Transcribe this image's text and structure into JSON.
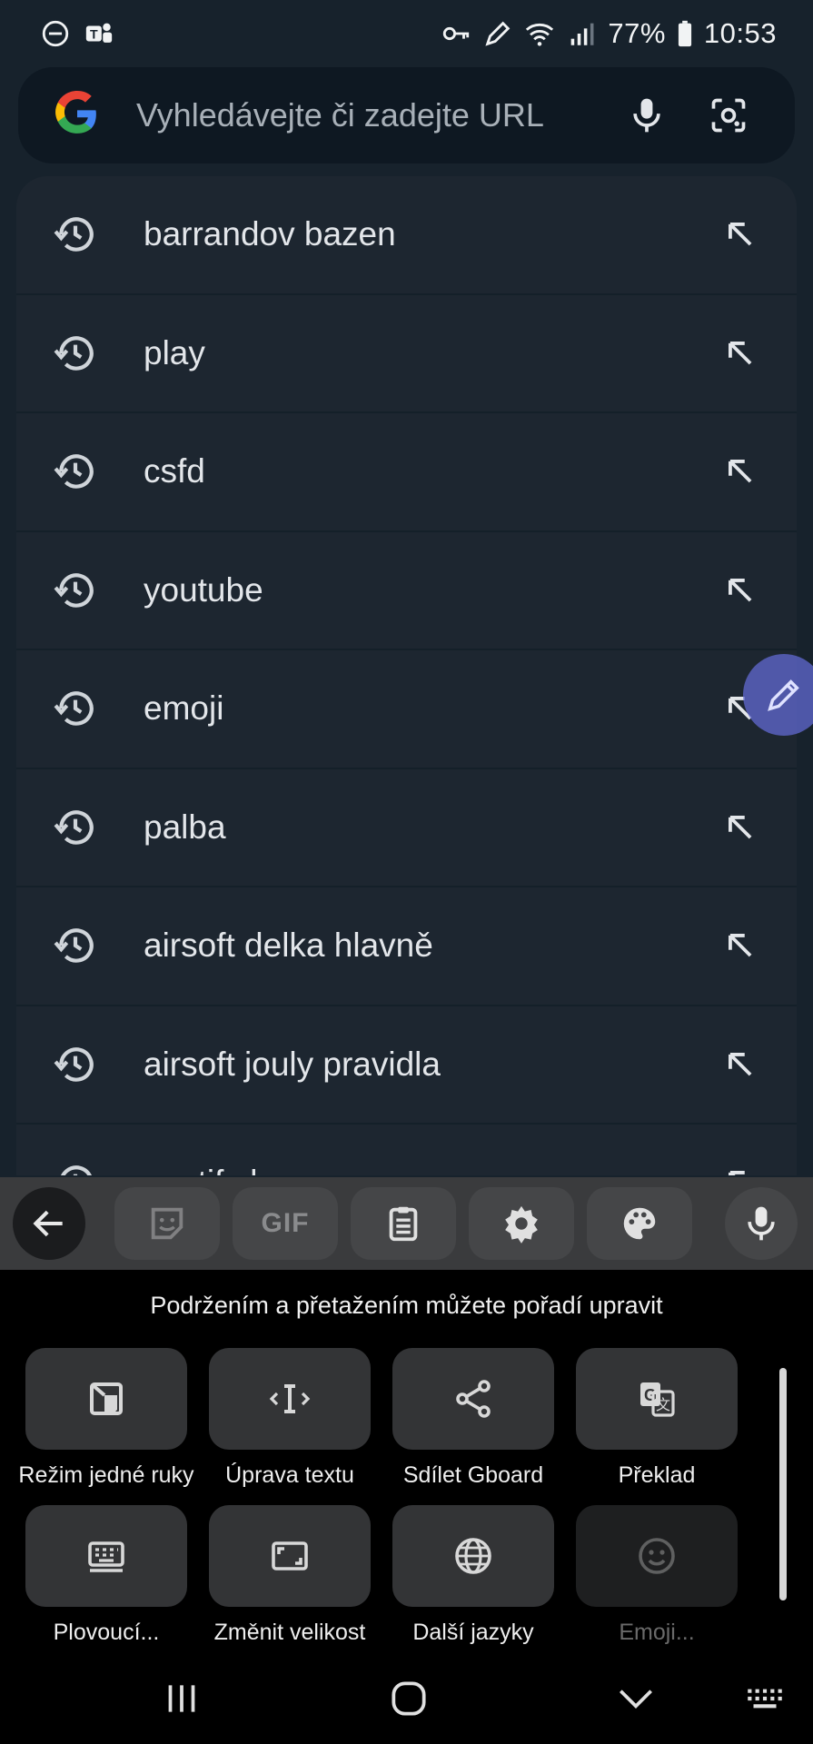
{
  "status_bar": {
    "battery": "77%",
    "time": "10:53",
    "left_icons": [
      "do-not-disturb-icon",
      "teams-icon"
    ],
    "right_icons": [
      "vpn-key-icon",
      "pen-icon",
      "wifi-icon",
      "signal-icon",
      "battery-icon"
    ]
  },
  "search": {
    "placeholder": "Vyhledávejte či zadejte URL",
    "icons": [
      "google-logo",
      "mic-icon",
      "lens-camera-icon"
    ]
  },
  "suggestions": [
    {
      "text": "barrandov bazen"
    },
    {
      "text": "play"
    },
    {
      "text": "csfd"
    },
    {
      "text": "youtube"
    },
    {
      "text": "emoji"
    },
    {
      "text": "palba"
    },
    {
      "text": "airsoft delka hlavně"
    },
    {
      "text": "airsoft jouly pravidla"
    },
    {
      "text": "spotify ba..."
    }
  ],
  "keyboard_toolbar": {
    "items": [
      "back-arrow-icon",
      "sticker-icon",
      "GIF",
      "clipboard-icon",
      "gear-icon",
      "palette-icon",
      "mic-icon"
    ],
    "gif_label": "GIF"
  },
  "keyboard_panel": {
    "hint": "Podržením a přetažením můžete pořadí upravit",
    "items": [
      {
        "label": "Režim jedné ruky",
        "icon": "one-hand-icon"
      },
      {
        "label": "Úprava textu",
        "icon": "text-cursor-icon"
      },
      {
        "label": "Sdílet Gboard",
        "icon": "share-icon"
      },
      {
        "label": "Překlad",
        "icon": "translate-icon"
      },
      {
        "label": "Plovoucí...",
        "icon": "keyboard-icon"
      },
      {
        "label": "Změnit velikost",
        "icon": "resize-icon"
      },
      {
        "label": "Další jazyky",
        "icon": "globe-icon"
      },
      {
        "label": "Emoji...",
        "icon": "emoji-icon"
      }
    ]
  },
  "nav_bar": {
    "icons": [
      "recents-icon",
      "home-icon",
      "hide-keyboard-icon",
      "keyboard-switch-icon"
    ]
  }
}
